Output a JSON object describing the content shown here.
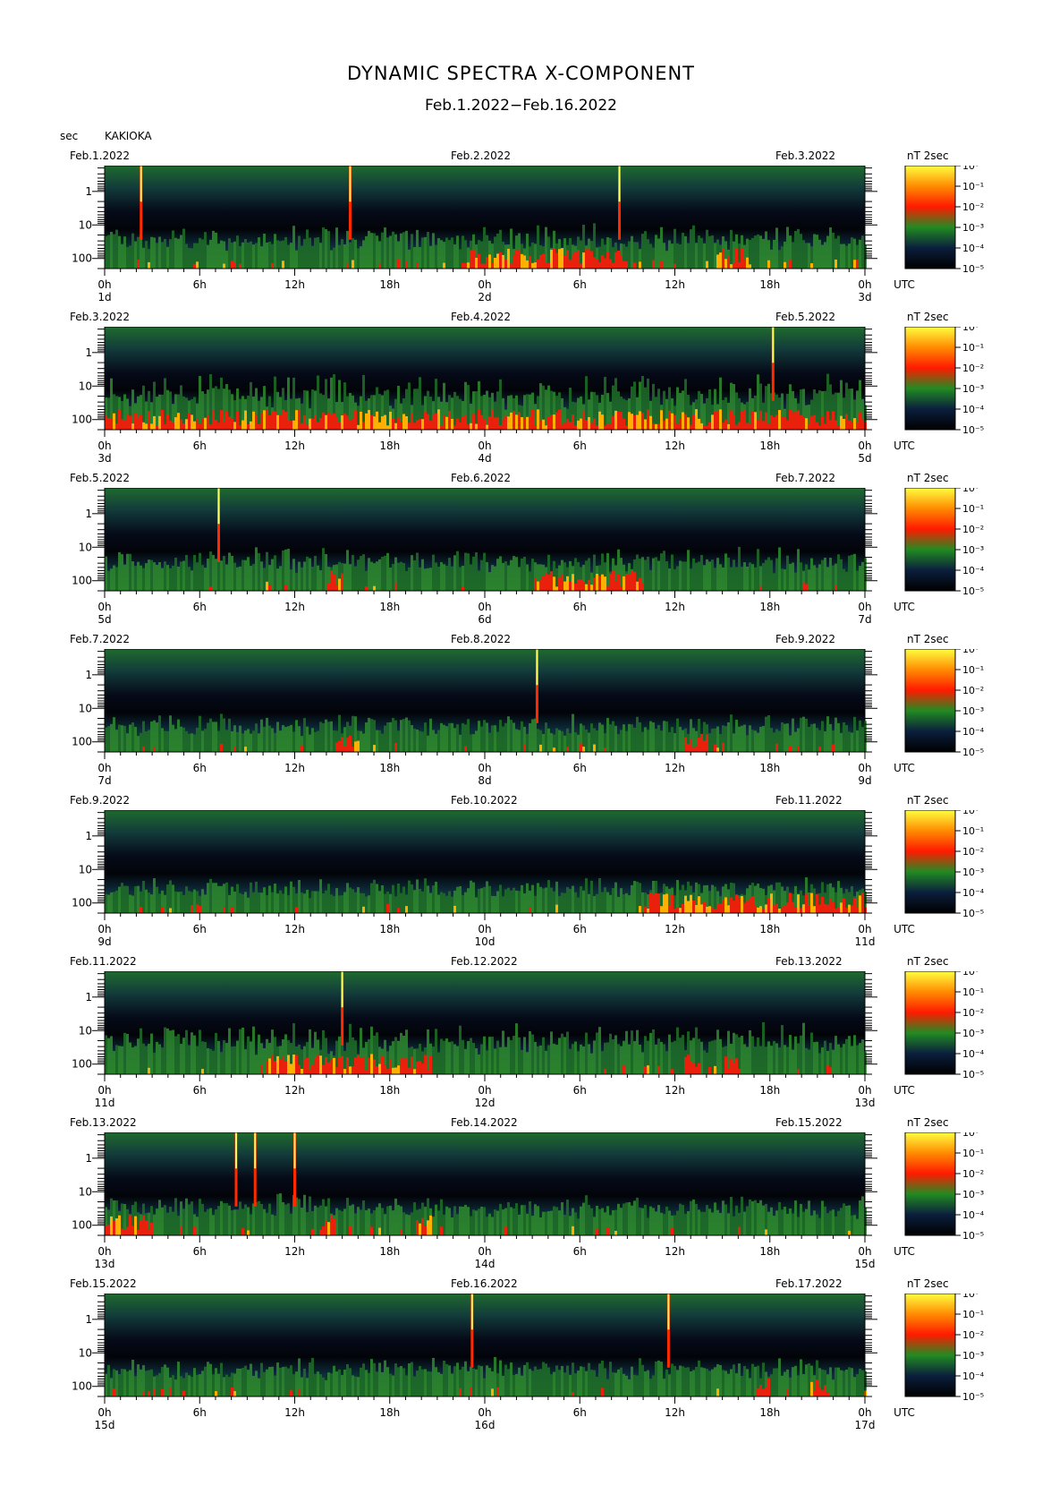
{
  "title": "DYNAMIC SPECTRA X-COMPONENT",
  "subtitle": "Feb.1.2022−Feb.16.2022",
  "unit_label": "sec",
  "station": "KAKIOKA",
  "colorbar_unit_prefix": "nT",
  "colorbar_unit_exp": "2",
  "colorbar_unit_suffix": "sec",
  "axis_timezone": "UTC",
  "chart_data": {
    "type": "heatmap",
    "y_axis": {
      "label": "sec",
      "scale": "log",
      "ticks": [
        "1",
        "10",
        "100"
      ]
    },
    "x_ticks": [
      "0h",
      "6h",
      "12h",
      "18h",
      "0h",
      "6h",
      "12h",
      "18h",
      "0h"
    ],
    "colorbar": {
      "ticks": [
        "10⁰",
        "10⁻¹",
        "10⁻²",
        "10⁻³",
        "10⁻⁴",
        "10⁻⁵"
      ],
      "colors": [
        "#ffff40",
        "#ff8c00",
        "#ff1a00",
        "#228b22",
        "#0a1e3c",
        "#000000"
      ]
    },
    "panels": [
      {
        "left_date": "Feb.1.2022",
        "mid_date": "Feb.2.2022",
        "right_date": "Feb.3.2022",
        "day_labels": [
          "1d",
          "2d",
          "3d"
        ],
        "spikes": [
          2.3,
          15.5,
          32.5
        ],
        "activity": 0.55,
        "red_bursts": [
          [
            22.5,
            33
          ],
          [
            38.5,
            40.5
          ]
        ]
      },
      {
        "left_date": "Feb.3.2022",
        "mid_date": "Feb.4.2022",
        "right_date": "Feb.5.2022",
        "day_labels": [
          "3d",
          "4d",
          "5d"
        ],
        "spikes": [
          42.2
        ],
        "activity": 0.85,
        "red_bursts": [
          [
            0,
            48
          ]
        ]
      },
      {
        "left_date": "Feb.5.2022",
        "mid_date": "Feb.6.2022",
        "right_date": "Feb.7.2022",
        "day_labels": [
          "5d",
          "6d",
          "7d"
        ],
        "spikes": [
          7.2
        ],
        "activity": 0.55,
        "red_bursts": [
          [
            14,
            15
          ],
          [
            27,
            34
          ]
        ]
      },
      {
        "left_date": "Feb.7.2022",
        "mid_date": "Feb.8.2022",
        "right_date": "Feb.9.2022",
        "day_labels": [
          "7d",
          "8d",
          "9d"
        ],
        "spikes": [
          27.3
        ],
        "activity": 0.4,
        "red_bursts": [
          [
            14.5,
            16
          ],
          [
            36.5,
            38
          ]
        ]
      },
      {
        "left_date": "Feb.9.2022",
        "mid_date": "Feb.10.2022",
        "right_date": "Feb.11.2022",
        "day_labels": [
          "9d",
          "10d",
          "11d"
        ],
        "spikes": [],
        "activity": 0.35,
        "red_bursts": [
          [
            34,
            48
          ]
        ]
      },
      {
        "left_date": "Feb.11.2022",
        "mid_date": "Feb.12.2022",
        "right_date": "Feb.13.2022",
        "day_labels": [
          "11d",
          "12d",
          "13d"
        ],
        "spikes": [
          15.0
        ],
        "activity": 0.7,
        "red_bursts": [
          [
            10,
            20.5
          ],
          [
            36.5,
            37.5
          ],
          [
            39,
            40
          ]
        ]
      },
      {
        "left_date": "Feb.13.2022",
        "mid_date": "Feb.14.2022",
        "right_date": "Feb.15.2022",
        "day_labels": [
          "13d",
          "14d",
          "15d"
        ],
        "spikes": [
          8.3,
          9.5,
          12.0
        ],
        "activity": 0.5,
        "red_bursts": [
          [
            0,
            3
          ],
          [
            13.5,
            14.5
          ],
          [
            19.5,
            20.5
          ]
        ]
      },
      {
        "left_date": "Feb.15.2022",
        "mid_date": "Feb.16.2022",
        "right_date": "Feb.17.2022",
        "day_labels": [
          "15d",
          "16d",
          "17d"
        ],
        "spikes": [
          23.2,
          35.6
        ],
        "activity": 0.45,
        "red_bursts": [
          [
            41,
            42
          ],
          [
            44.5,
            45.5
          ]
        ]
      }
    ]
  }
}
